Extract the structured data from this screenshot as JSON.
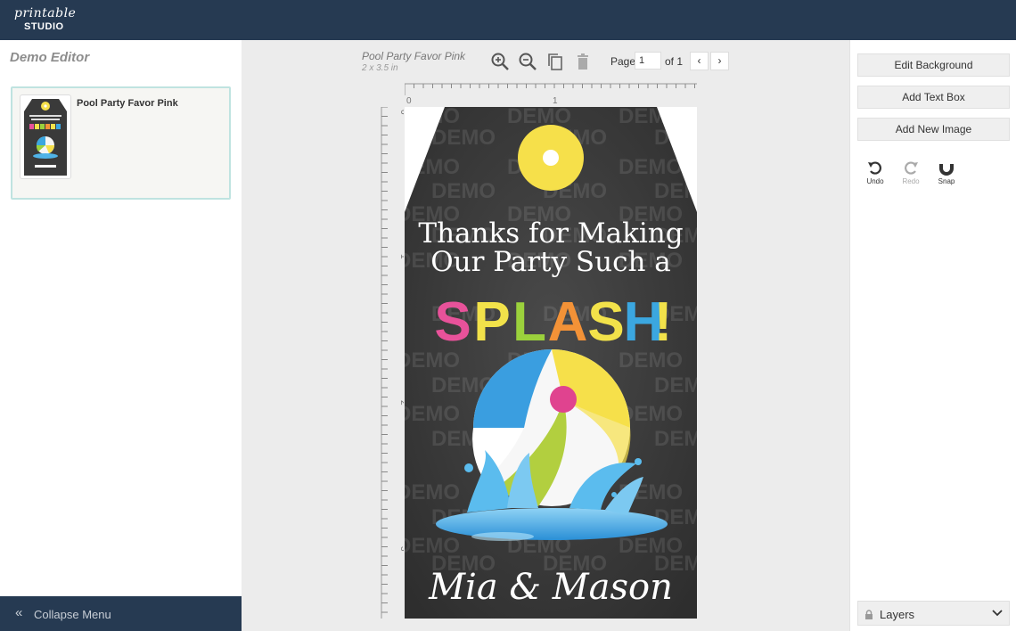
{
  "app": {
    "logo_script": "printable",
    "logo_studio": "STUDIO"
  },
  "left_panel": {
    "title": "Demo Editor",
    "designs": [
      {
        "name": "Pool Party Favor Pink"
      }
    ],
    "collapse_label": "Collapse Menu"
  },
  "document": {
    "name": "Pool Party Favor Pink",
    "size": "2 x 3.5 in"
  },
  "toolbar": {
    "icons": [
      "zoom-in-icon",
      "zoom-out-icon",
      "copy-icon",
      "trash-icon"
    ],
    "page_label": "Page",
    "page_value": "1",
    "page_total": "of 1"
  },
  "rulers": {
    "top_labels": [
      "0",
      "1"
    ],
    "left_labels": [
      "0",
      "1",
      "2",
      "3"
    ]
  },
  "tag": {
    "line1": "Thanks for Making",
    "line2": "Our Party Such a",
    "splash_letters": [
      {
        "char": "S",
        "color": "#e8529a"
      },
      {
        "char": "P",
        "color": "#f2e24a"
      },
      {
        "char": "L",
        "color": "#9bd13c"
      },
      {
        "char": "A",
        "color": "#f39237"
      },
      {
        "char": "S",
        "color": "#f2e24a"
      },
      {
        "char": "H",
        "color": "#3ba7e0"
      },
      {
        "char": "!",
        "color": "#f2e24a"
      }
    ],
    "names": "Mia & Mason",
    "watermark": "DEMO"
  },
  "right_panel": {
    "edit_background": "Edit Background",
    "add_text_box": "Add Text Box",
    "add_new_image": "Add New Image",
    "undo": "Undo",
    "redo": "Redo",
    "snap": "Snap",
    "layers": "Layers"
  },
  "colors": {
    "header": "#263a52",
    "chalkboard": "#3a3a3a",
    "grommet": "#f6e04a"
  }
}
